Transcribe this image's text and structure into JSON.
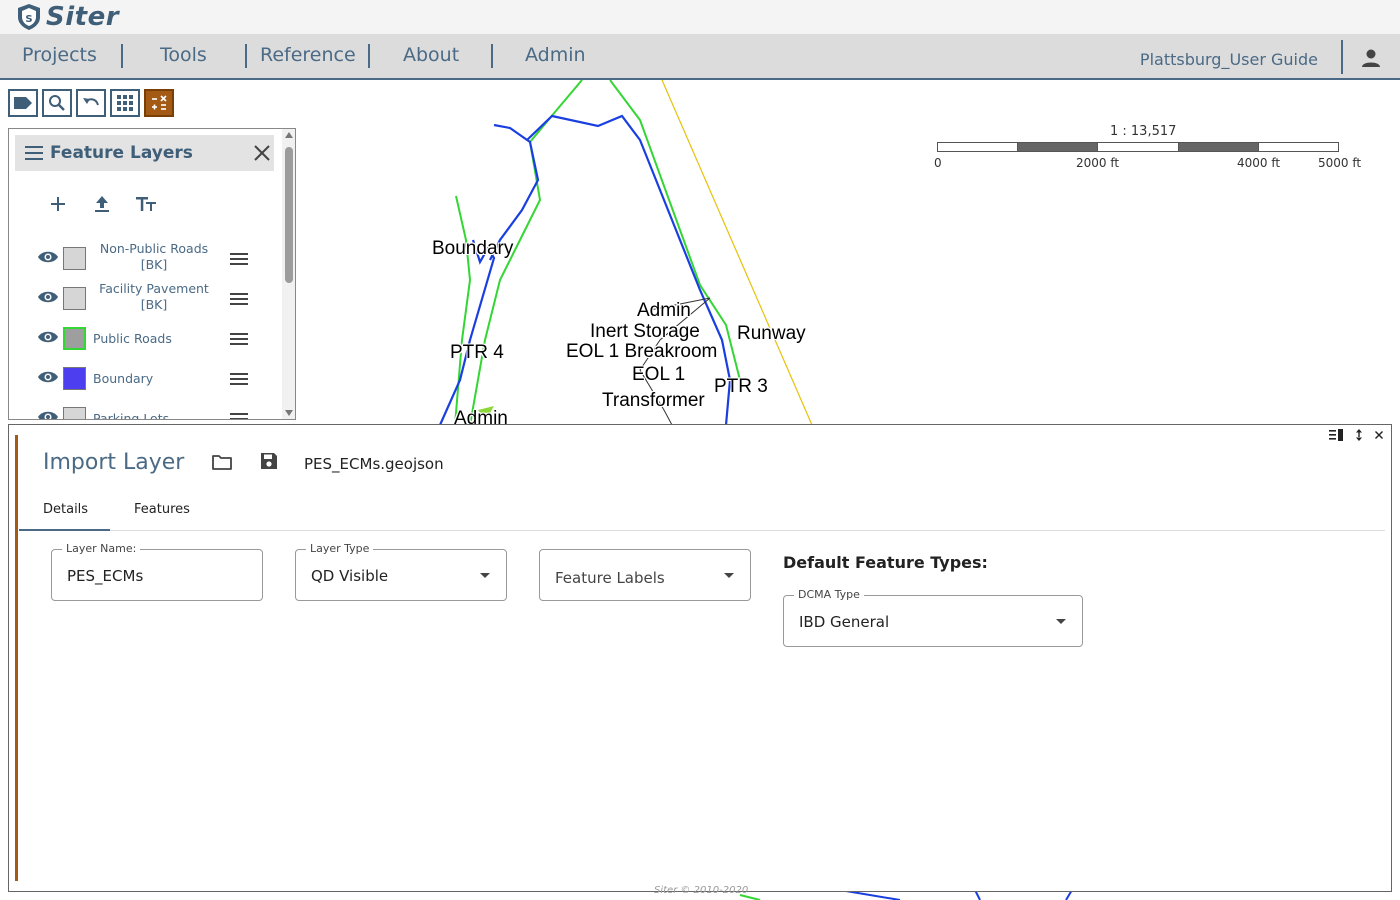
{
  "brand": {
    "name": "Siter"
  },
  "nav": {
    "items": [
      "Projects",
      "Tools",
      "Reference",
      "About",
      "Admin"
    ],
    "project_name": "Plattsburg_User Guide"
  },
  "map": {
    "labels": [
      "Boundary",
      "PTR 4",
      "Admin",
      "Inert Storage",
      "Runway",
      "EOL 1 Breakroom",
      "EOL 1",
      "PTR 3",
      "Transformer",
      "Admin"
    ],
    "scale": {
      "ratio": "1 : 13,517",
      "ticks": [
        "0",
        "2000 ft",
        "4000 ft",
        "5000 ft"
      ]
    }
  },
  "layers_panel": {
    "title": "Feature Layers",
    "items": [
      {
        "name": "Non-Public Roads\n[BK]",
        "color": "#d6d6d6"
      },
      {
        "name": "Facility Pavement\n[BK]",
        "color": "#d6d6d6"
      },
      {
        "name": "Public Roads",
        "color": "#9e9e9e"
      },
      {
        "name": "Boundary",
        "color": "#4d3ff0"
      },
      {
        "name": "Parking Lots",
        "color": "#d6d6d6"
      }
    ]
  },
  "import_dialog": {
    "title": "Import Layer",
    "filename": "PES_ECMs.geojson",
    "tabs": [
      "Details",
      "Features"
    ],
    "layer_name": {
      "label": "Layer Name:",
      "value": "PES_ECMs"
    },
    "layer_type": {
      "label": "Layer Type",
      "value": "QD Visible"
    },
    "feature_labels": {
      "placeholder": "Feature Labels"
    },
    "default_types_heading": "Default Feature Types:",
    "dcma_type": {
      "label": "DCMA Type",
      "value": "IBD General"
    }
  },
  "footer": {
    "copyright": "Siter © 2010-2020"
  },
  "colors": {
    "accent": "#a35a14",
    "primary": "#4a6a86"
  }
}
